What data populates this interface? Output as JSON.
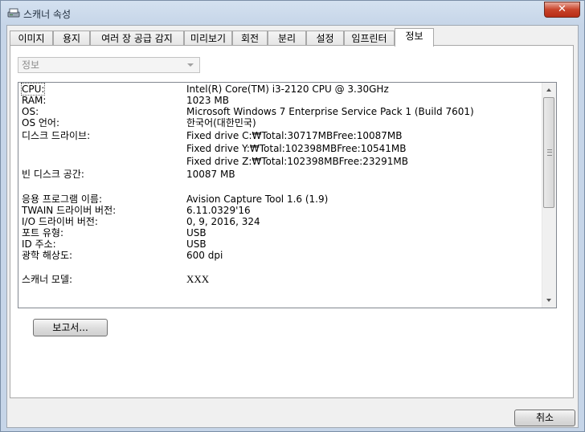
{
  "window": {
    "title": "스캐너 속성",
    "close_glyph": "✕"
  },
  "tabs": [
    {
      "label": "이미지"
    },
    {
      "label": "용지"
    },
    {
      "label": "여러 장 공급 감지"
    },
    {
      "label": "미리보기"
    },
    {
      "label": "회전"
    },
    {
      "label": "분리"
    },
    {
      "label": "설정"
    },
    {
      "label": "임프린터"
    },
    {
      "label": "정보"
    }
  ],
  "active_tab": "정보",
  "info_select": {
    "value": "정보"
  },
  "info_rows": [
    {
      "label": "CPU:",
      "value": "Intel(R) Core(TM) i3-2120 CPU @ 3.30GHz"
    },
    {
      "label": "RAM:",
      "value": "1023 MB"
    },
    {
      "label": "OS:",
      "value": "Microsoft Windows 7 Enterprise Service Pack 1 (Build 7601)"
    },
    {
      "label": "OS 언어:",
      "value": "한국어(대한민국)"
    },
    {
      "label": "디스크 드라이브:",
      "value": "Fixed drive C:₩Total:30717MBFree:10087MB"
    },
    {
      "label": "",
      "value": "Fixed drive Y:₩Total:102398MBFree:10541MB"
    },
    {
      "label": "",
      "value": "Fixed drive Z:₩Total:102398MBFree:23291MB"
    },
    {
      "label": "빈 디스크 공간:",
      "value": "10087 MB"
    },
    {
      "label": "응용 프로그램 이름:",
      "value": "Avision Capture Tool 1.6 (1.9)"
    },
    {
      "label": "TWAIN 드라이버 버전:",
      "value": "6.11.0329'16"
    },
    {
      "label": "I/O 드라이버 버전:",
      "value": "0, 9, 2016, 324"
    },
    {
      "label": "포트 유형:",
      "value": "USB"
    },
    {
      "label": "ID 주소:",
      "value": "USB"
    },
    {
      "label": "광학 해상도:",
      "value": "600 dpi"
    },
    {
      "label": "스캐너 모델:",
      "value": "XXX"
    }
  ],
  "buttons": {
    "report": "보고서...",
    "cancel": "취소"
  },
  "colors": {
    "close_button": "#c8432a",
    "title_bar": "#c6d5e8"
  }
}
